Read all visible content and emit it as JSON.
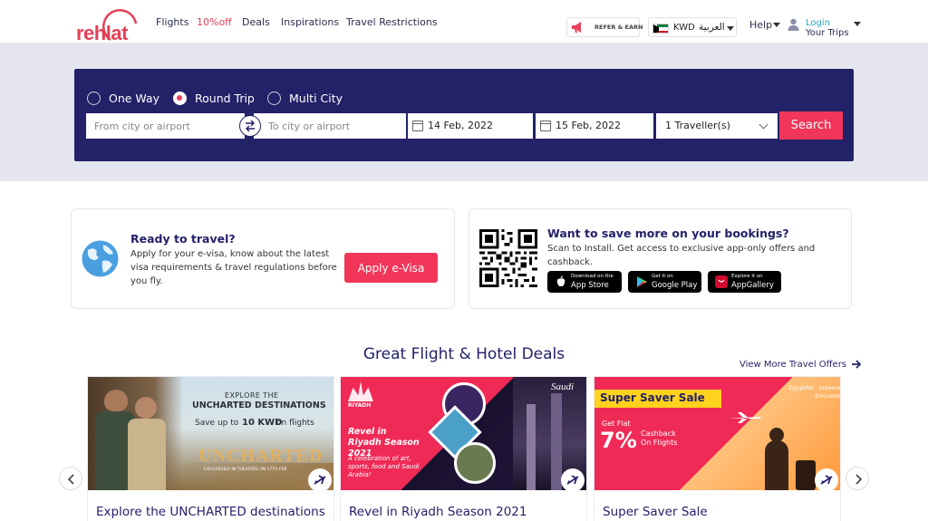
{
  "header": {
    "logo_text": "rehlat",
    "nav": [
      {
        "label": "Flights"
      },
      {
        "label": "10%off"
      },
      {
        "label": "Deals"
      },
      {
        "label": "Inspirations"
      },
      {
        "label": "Travel Restrictions"
      }
    ],
    "refer_label": "REFER & EARN",
    "currency": "KWD",
    "language": "العربية",
    "help_label": "Help",
    "login_label": "Login",
    "trips_label": "Your Trips"
  },
  "search": {
    "trip_types": [
      "One Way",
      "Round Trip",
      "Multi City"
    ],
    "selected_trip_type": "Round Trip",
    "from_placeholder": "From city or airport",
    "to_placeholder": "To city or airport",
    "depart_date": "14 Feb, 2022",
    "return_date": "15 Feb, 2022",
    "travellers": "1 Traveller(s)",
    "search_label": "Search"
  },
  "visa_card": {
    "title": "Ready to travel?",
    "body": "Apply for your e-visa, know about the latest visa requirements & travel regulations before you fly.",
    "button": "Apply e-Visa"
  },
  "app_card": {
    "title": "Want to save more on your bookings?",
    "body": "Scan to Install. Get access to exclusive app-only offers and cashback.",
    "stores": [
      {
        "small": "Download on the",
        "big": "App Store",
        "icon": "apple-icon"
      },
      {
        "small": "Get it on",
        "big": "Google Play",
        "icon": "google-play-icon"
      },
      {
        "small": "Explore it on",
        "big": "AppGallery",
        "icon": "huawei-icon"
      }
    ]
  },
  "deals": {
    "title": "Great Flight & Hotel Deals",
    "view_more": "View More Travel Offers",
    "items": [
      {
        "caption": "Explore the UNCHARTED destinations",
        "banner_line1": "EXPLORE THE",
        "banner_line2": "UNCHARTED DESTINATIONS",
        "banner_line3": "Save up to",
        "banner_line3b": "10 KWD",
        "banner_line3c": "on flights",
        "banner_movie": "UNCHARTED",
        "banner_tag": "EXCLUSIVELY IN THEATERS ON 17TH FEB"
      },
      {
        "caption": "Revel in Riyadh Season 2021",
        "banner_brand": "RIYADH",
        "banner_title": "Revel in Riyadh Season 2021",
        "banner_sub": "A celebration of art, sports, food and Saudi Arabia!",
        "banner_logo": "Saudi"
      },
      {
        "caption": "Super Saver Sale",
        "banner_title": "Super Saver Sale",
        "banner_getflat": "Get Flat",
        "banner_pct": "7%",
        "banner_cashback": "Cashback On Flights",
        "banner_airlines": "EgyptAir · Jazeera · Emirates"
      }
    ]
  },
  "colors": {
    "brand_red": "#f1365a",
    "navy": "#232168",
    "band_bg": "#e5e5ef"
  }
}
